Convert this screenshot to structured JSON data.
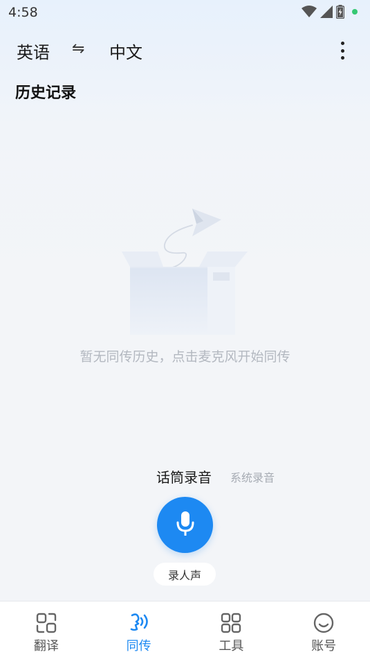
{
  "status_bar": {
    "time": "4:58",
    "icons": [
      "wifi-icon",
      "cell-signal-icon",
      "battery-charging-icon",
      "status-dot"
    ]
  },
  "language_bar": {
    "source": "英语",
    "swap_symbol": "⇋",
    "target": "中文",
    "more_icon": "more-vertical-icon"
  },
  "history": {
    "title": "历史记录",
    "empty_message": "暂无同传历史，点击麦克风开始同传"
  },
  "record_modes": {
    "mic": "话筒录音",
    "system": "系统录音",
    "selected": "mic"
  },
  "mic_button": {
    "icon": "microphone-icon"
  },
  "voice_chip": {
    "label": "录人声"
  },
  "bottom_nav": {
    "items": [
      {
        "label": "翻译",
        "icon": "translate-icon",
        "active": false
      },
      {
        "label": "同传",
        "icon": "interpret-icon",
        "active": true
      },
      {
        "label": "工具",
        "icon": "grid-tools-icon",
        "active": false
      },
      {
        "label": "账号",
        "icon": "smiley-account-icon",
        "active": false
      }
    ]
  },
  "colors": {
    "accent": "#1d89f2",
    "status_dot": "#35c873",
    "muted_text": "#b3b8c0"
  }
}
